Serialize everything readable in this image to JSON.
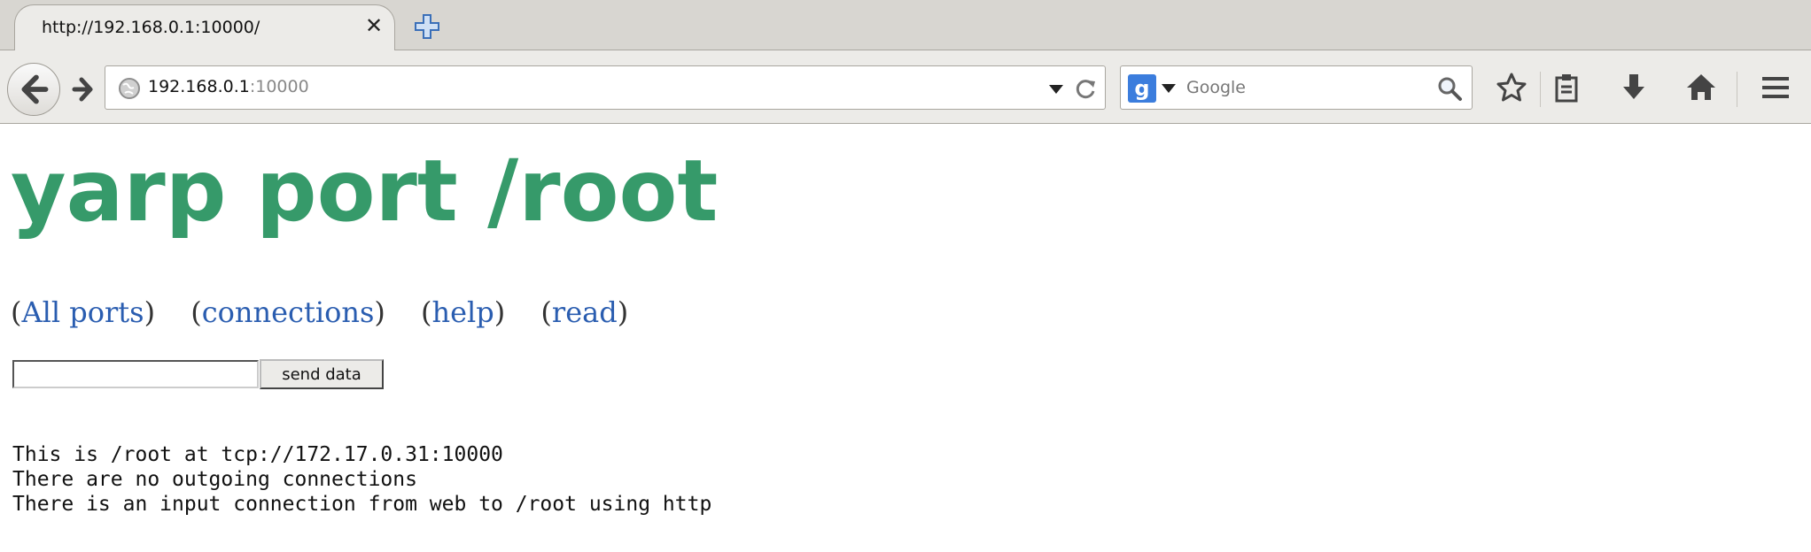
{
  "browser": {
    "tab": {
      "title": "http://192.168.0.1:10000/"
    },
    "url": {
      "host": "192.168.0.1",
      "port": ":10000"
    },
    "search": {
      "placeholder": "Google",
      "engine_logo": "g"
    },
    "icons": {
      "back": "back-arrow-icon",
      "forward": "forward-arrow-icon",
      "close_tab": "close-icon",
      "new_tab": "plus-icon",
      "site": "globe-icon",
      "url_dropdown": "dropdown-arrow-icon",
      "reload": "reload-icon",
      "search_engine": "google-icon",
      "search": "magnifier-icon",
      "bookmark": "star-icon",
      "reading_list": "clipboard-icon",
      "downloads": "download-arrow-icon",
      "home": "home-icon",
      "menu": "hamburger-menu-icon"
    }
  },
  "page": {
    "title": "yarp port /root",
    "nav_links": [
      "All ports",
      "connections",
      "help",
      "read"
    ],
    "send_button": "send data",
    "input_value": "",
    "info_lines": [
      "This is /root at tcp://172.17.0.31:10000",
      "There are no outgoing connections",
      "There is an input connection from web to /root using http"
    ],
    "colors": {
      "title": "#369a6a",
      "link": "#2a5db0"
    }
  }
}
